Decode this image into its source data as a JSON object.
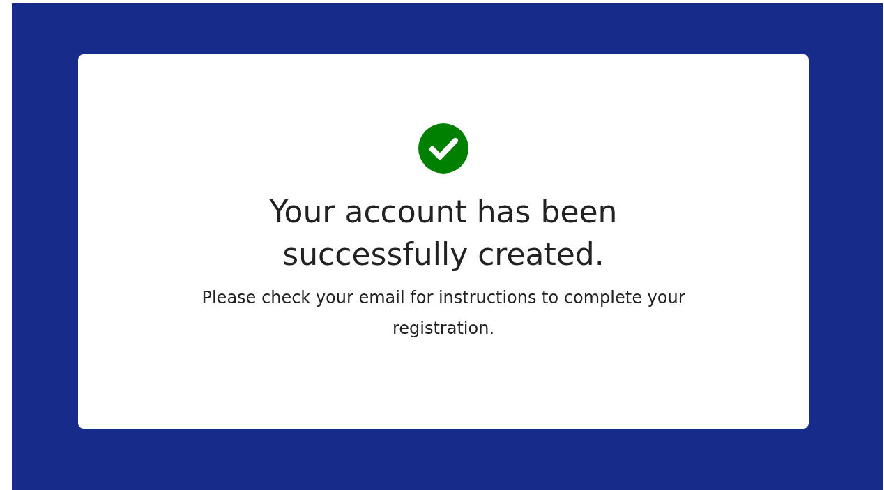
{
  "confirmation": {
    "heading": "Your account has been successfully created.",
    "message": "Please check your email for instructions to complete your registration."
  }
}
